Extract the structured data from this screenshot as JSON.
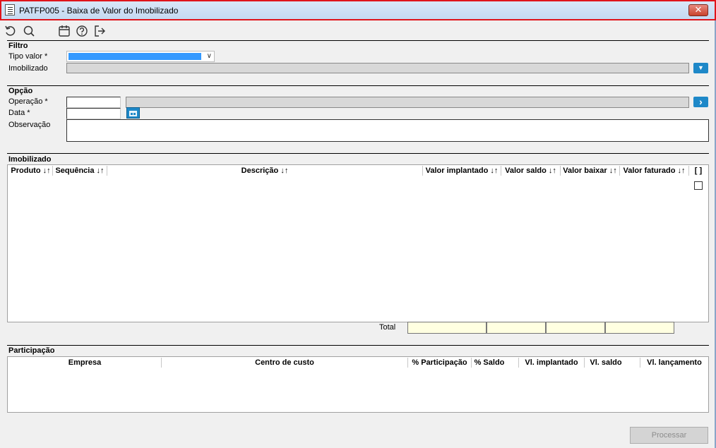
{
  "window": {
    "title": "PATFP005 - Baixa de Valor do Imobilizado",
    "close_glyph": "✕"
  },
  "toolbar": {
    "icons": [
      "undo-icon",
      "search-icon",
      "calendar-icon",
      "help-icon",
      "exit-icon"
    ]
  },
  "filtro": {
    "section_title": "Filtro",
    "tipo_valor_label": "Tipo valor *",
    "tipo_valor_value": "",
    "imobilizado_label": "Imobilizado",
    "imobilizado_value": "",
    "filter_button_glyph": "▼"
  },
  "opcao": {
    "section_title": "Opção",
    "operacao_label": "Operação *",
    "operacao_code": "",
    "operacao_desc": "",
    "operacao_button_glyph": "›",
    "data_label": "Data *",
    "data_value": "",
    "observacao_label": "Observação",
    "observacao_value": ""
  },
  "imobilizado_grid": {
    "section_title": "Imobilizado",
    "columns": [
      "Produto ↓↑",
      "Sequência ↓↑",
      "Descrição ↓↑",
      "Valor implantado ↓↑",
      "Valor saldo ↓↑",
      "Valor baixar ↓↑",
      "Valor faturado ↓↑",
      "[ ]"
    ],
    "rows": [],
    "total_label": "Total",
    "totals": [
      "",
      "",
      "",
      ""
    ]
  },
  "participacao": {
    "section_title": "Participação",
    "columns": [
      "Empresa",
      "Centro de custo",
      "% Participação",
      "% Saldo",
      "Vl. implantado",
      "Vl. saldo",
      "Vl. lançamento"
    ],
    "rows": []
  },
  "footer": {
    "processar_label": "Processar"
  },
  "colors": {
    "title_border": "#e0141b",
    "accent_blue": "#1e88c8",
    "selection_blue": "#3399ff",
    "total_cell_bg": "#ffffe1"
  }
}
